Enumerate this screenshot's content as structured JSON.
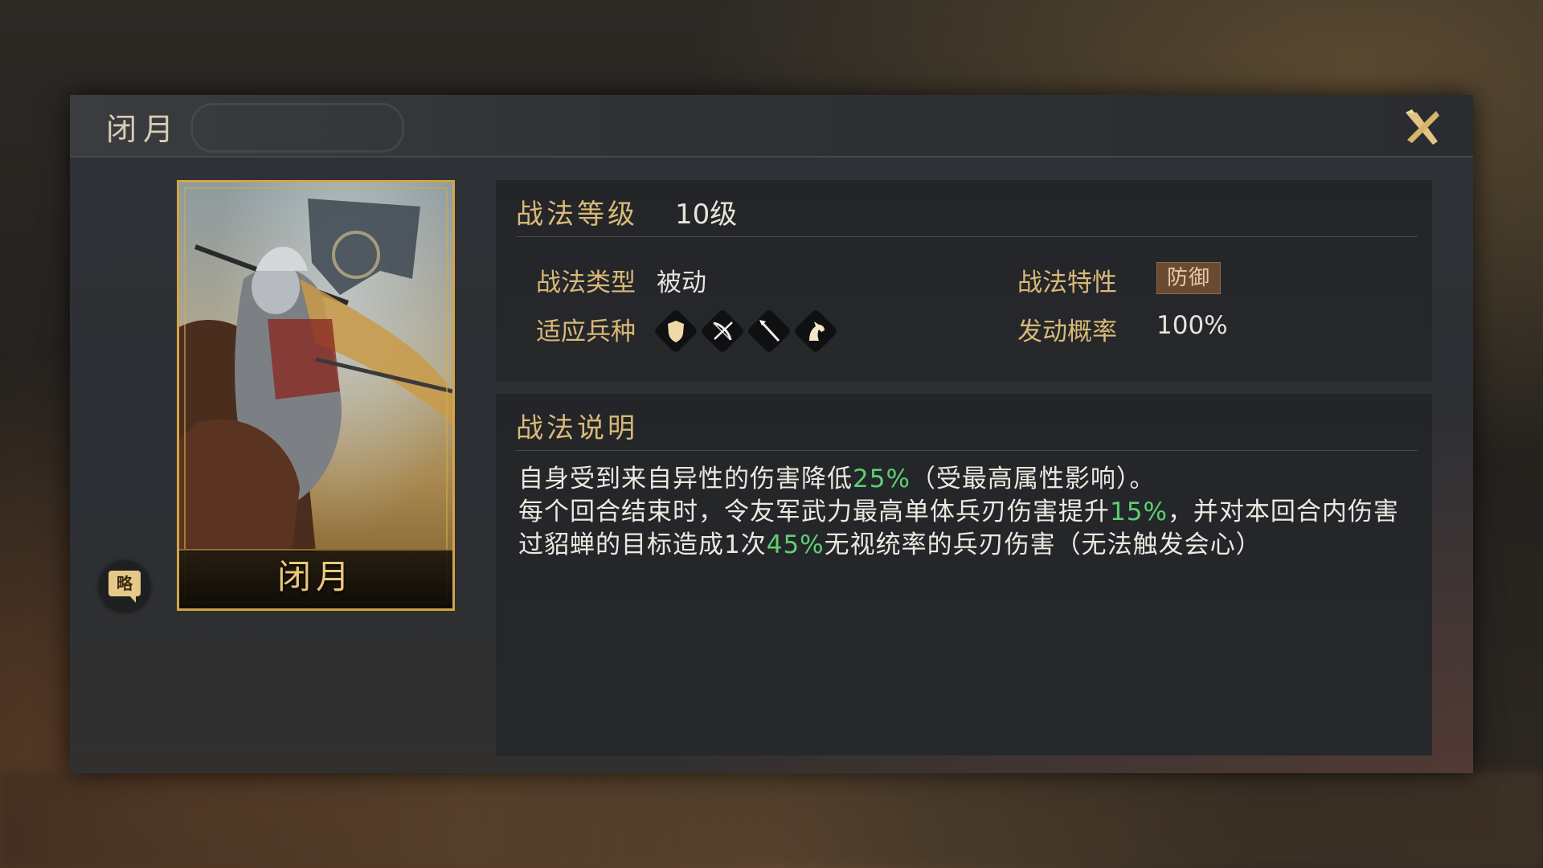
{
  "window": {
    "title": "闭月"
  },
  "card": {
    "name": "闭月"
  },
  "strategy_badge": {
    "label": "略"
  },
  "skill_level": {
    "label": "战法等级",
    "value": "10级"
  },
  "attributes": {
    "type_label": "战法类型",
    "type_value": "被动",
    "trait_label": "战法特性",
    "trait_value": "防御",
    "troops_label": "适应兵种",
    "troops": [
      "shield-icon",
      "bow-icon",
      "spear-icon",
      "horse-icon"
    ],
    "rate_label": "发动概率",
    "rate_value": "100%"
  },
  "description": {
    "label": "战法说明",
    "line1_a": "自身受到来自异性的伤害降低",
    "line1_pct": "25%",
    "line1_b": "（受最高属性影响）。",
    "line2_a": "每个回合结束时，令友军武力最高单体兵刃伤害提升",
    "line2_pct": "15%",
    "line2_b": "，并对本回合内伤害过貂蝉的目标造成1次",
    "line2_pct2": "45%",
    "line2_c": "无视统率的兵刃伤害（无法触发会心）"
  },
  "colors": {
    "gold_label": "#d9b978",
    "highlight_green": "#5fcf72",
    "card_border": "#d4a445"
  }
}
